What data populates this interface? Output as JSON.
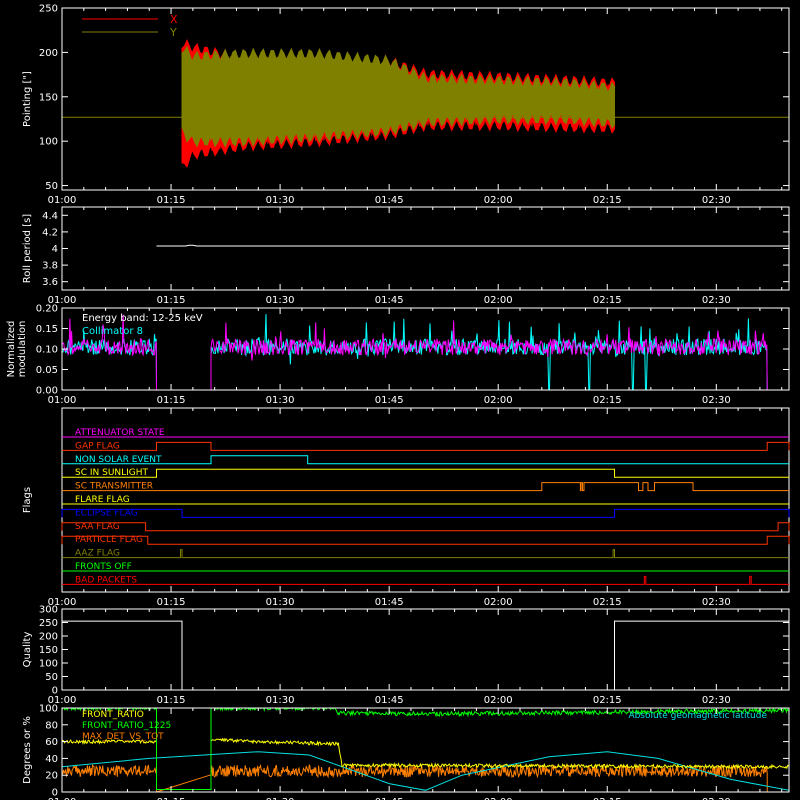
{
  "time_axis": {
    "tick_labels": [
      "01:00",
      "01:15",
      "01:30",
      "01:45",
      "02:00",
      "02:15",
      "02:30"
    ],
    "range_minutes": [
      0,
      100
    ]
  },
  "chart_data": [
    {
      "id": "pointing",
      "type": "line",
      "ylabel": "Pointing [\"]",
      "ylim": [
        45,
        250
      ],
      "yticks": [
        50,
        100,
        150,
        200,
        250
      ],
      "legend_placement": "top-left",
      "series": [
        {
          "name": "X",
          "color": "#ff0000",
          "data_start_min": 16.5,
          "data_end_min": 76,
          "envelope": [
            {
              "t": 16.5,
              "low": 70,
              "high": 210
            },
            {
              "t": 18,
              "low": 85,
              "high": 205
            },
            {
              "t": 25,
              "low": 95,
              "high": 192
            },
            {
              "t": 35,
              "low": 100,
              "high": 195
            },
            {
              "t": 45,
              "low": 108,
              "high": 190
            },
            {
              "t": 50,
              "low": 118,
              "high": 175
            },
            {
              "t": 60,
              "low": 118,
              "high": 172
            },
            {
              "t": 70,
              "low": 116,
              "high": 168
            },
            {
              "t": 76,
              "low": 115,
              "high": 165
            }
          ]
        },
        {
          "name": "Y",
          "color": "#808000",
          "data_start_min": 16.5,
          "data_end_min": 76,
          "envelope": [
            {
              "t": 16.5,
              "low": 110,
              "high": 205
            },
            {
              "t": 18,
              "low": 100,
              "high": 195
            },
            {
              "t": 25,
              "low": 100,
              "high": 198
            },
            {
              "t": 35,
              "low": 105,
              "high": 198
            },
            {
              "t": 45,
              "low": 112,
              "high": 190
            },
            {
              "t": 50,
              "low": 122,
              "high": 170
            },
            {
              "t": 60,
              "low": 125,
              "high": 168
            },
            {
              "t": 70,
              "low": 125,
              "high": 165
            },
            {
              "t": 76,
              "low": 120,
              "high": 160
            }
          ],
          "baseline": 127
        }
      ]
    },
    {
      "id": "roll",
      "type": "line",
      "ylabel": "Roll period [s]",
      "ylim": [
        3.5,
        4.5
      ],
      "yticks": [
        3.6,
        3.8,
        4.0,
        4.2,
        4.4
      ],
      "series": [
        {
          "color": "#ffffff",
          "points": [
            [
              13,
              4.03
            ],
            [
              17,
              4.03
            ],
            [
              17.5,
              4.04
            ],
            [
              18,
              4.04
            ],
            [
              18.5,
              4.03
            ],
            [
              100,
              4.03
            ]
          ]
        }
      ]
    },
    {
      "id": "modulation",
      "type": "line",
      "ylabel": [
        "Normalized",
        "modulation"
      ],
      "ylim": [
        0.0,
        0.2
      ],
      "yticks": [
        "0.00",
        "0.05",
        "0.10",
        "0.15",
        "0.20"
      ],
      "annotations": [
        "Energy band: 12-25 keV",
        "Collimator 8"
      ],
      "series": [
        {
          "name": "Collimator 8",
          "color": "#00ffff",
          "mean": 0.105,
          "active_ranges": [
            [
              0,
              13
            ],
            [
              20.5,
              97
            ]
          ]
        },
        {
          "name": "",
          "color": "#ff00ff",
          "mean": 0.105,
          "active_ranges": [
            [
              0,
              13
            ],
            [
              20.5,
              97
            ]
          ]
        }
      ],
      "cyan_dropouts_min": [
        67,
        72.5,
        78.5,
        80.3
      ]
    },
    {
      "id": "flags",
      "type": "line",
      "ylabel": "Flags",
      "flags": [
        {
          "label": "ATTENUATOR STATE",
          "color": "#ff00ff",
          "segments": [
            [
              0,
              0
            ]
          ]
        },
        {
          "label": "GAP FLAG",
          "color": "#ff3300",
          "segments": [
            [
              13,
              20.5
            ],
            [
              97,
              100
            ]
          ]
        },
        {
          "label": "NON SOLAR EVENT",
          "color": "#00ffff",
          "segments": [
            [
              20.5,
              33.8
            ]
          ]
        },
        {
          "label": "SC IN SUNLIGHT",
          "color": "#ffff00",
          "segments": [
            [
              13,
              76
            ]
          ]
        },
        {
          "label": "SC TRANSMITTER",
          "color": "#ff8000",
          "segments": [
            [
              66,
              71.3
            ],
            [
              71.4,
              71.6
            ],
            [
              71.8,
              79.3
            ],
            [
              79.9,
              80.6
            ],
            [
              81.5,
              86.8
            ]
          ]
        },
        {
          "label": "FLARE FLAG",
          "color": "#ffff00",
          "segments": [
            [
              0,
              0
            ]
          ]
        },
        {
          "label": "ECLIPSE FLAG",
          "color": "#0000ff",
          "segments": [
            [
              0,
              16.5
            ],
            [
              76,
              100
            ]
          ]
        },
        {
          "label": "SAA FLAG",
          "color": "#ff3300",
          "segments": [
            [
              0,
              11.5
            ],
            [
              98.5,
              100
            ]
          ]
        },
        {
          "label": "PARTICLE FLAG",
          "color": "#ff3300",
          "segments": [
            [
              0,
              11.8
            ],
            [
              97,
              100
            ]
          ]
        },
        {
          "label": "AAZ FLAG",
          "color": "#808000",
          "segments": [
            [
              16.3,
              16.5
            ],
            [
              75.8,
              76.0
            ]
          ]
        },
        {
          "label": "FRONTS OFF",
          "color": "#00ff00",
          "segments": [
            [
              0,
              0
            ]
          ]
        },
        {
          "label": "BAD PACKETS",
          "color": "#ff0000",
          "segments": [
            [
              80.1,
              80.3
            ],
            [
              94.6,
              94.8
            ]
          ]
        }
      ]
    },
    {
      "id": "quality",
      "type": "line",
      "ylabel": "Quality",
      "ylim": [
        0,
        300
      ],
      "yticks": [
        0,
        50,
        100,
        150,
        200,
        250,
        300
      ],
      "series": [
        {
          "color": "#ffffff",
          "points": [
            [
              0,
              255
            ],
            [
              16.5,
              255
            ],
            [
              16.5,
              0
            ],
            [
              76,
              0
            ],
            [
              76,
              255
            ],
            [
              100,
              255
            ]
          ]
        }
      ]
    },
    {
      "id": "diagnostics",
      "type": "line",
      "ylabel": "Degrees or %",
      "ylim": [
        0,
        100
      ],
      "yticks": [
        0,
        20,
        40,
        60,
        80,
        100
      ],
      "annotations": [
        "Absolute geomagnetic latitude"
      ],
      "series": [
        {
          "name": "FRONT_RATIO",
          "color": "#ffff00",
          "points": [
            [
              0,
              60
            ],
            [
              13,
              60
            ],
            [
              13,
              3
            ],
            [
              20.5,
              3
            ],
            [
              20.5,
              62
            ],
            [
              38,
              57
            ],
            [
              38.5,
              32
            ],
            [
              100,
              30
            ]
          ]
        },
        {
          "name": "FRONT_RATIO_1225",
          "color": "#00ff00",
          "points": [
            [
              0,
              100
            ],
            [
              13,
              100
            ],
            [
              13,
              3
            ],
            [
              20.5,
              3
            ],
            [
              20.5,
              100
            ],
            [
              37.5,
              100
            ],
            [
              38,
              94
            ],
            [
              52,
              93
            ],
            [
              100,
              97
            ]
          ]
        },
        {
          "name": "MAX_DET_VS_TOT",
          "color": "#ff8000",
          "mean": 25,
          "active_ranges": [
            [
              0,
              13
            ],
            [
              20.5,
              97
            ]
          ]
        },
        {
          "name": "",
          "color": "#00e0e0",
          "points": [
            [
              0,
              30
            ],
            [
              12,
              40
            ],
            [
              27,
              48
            ],
            [
              34,
              44
            ],
            [
              45,
              10
            ],
            [
              50,
              2
            ],
            [
              55,
              20
            ],
            [
              67,
              42
            ],
            [
              75,
              48
            ],
            [
              82,
              40
            ],
            [
              92,
              15
            ],
            [
              100,
              2
            ]
          ]
        }
      ]
    }
  ]
}
